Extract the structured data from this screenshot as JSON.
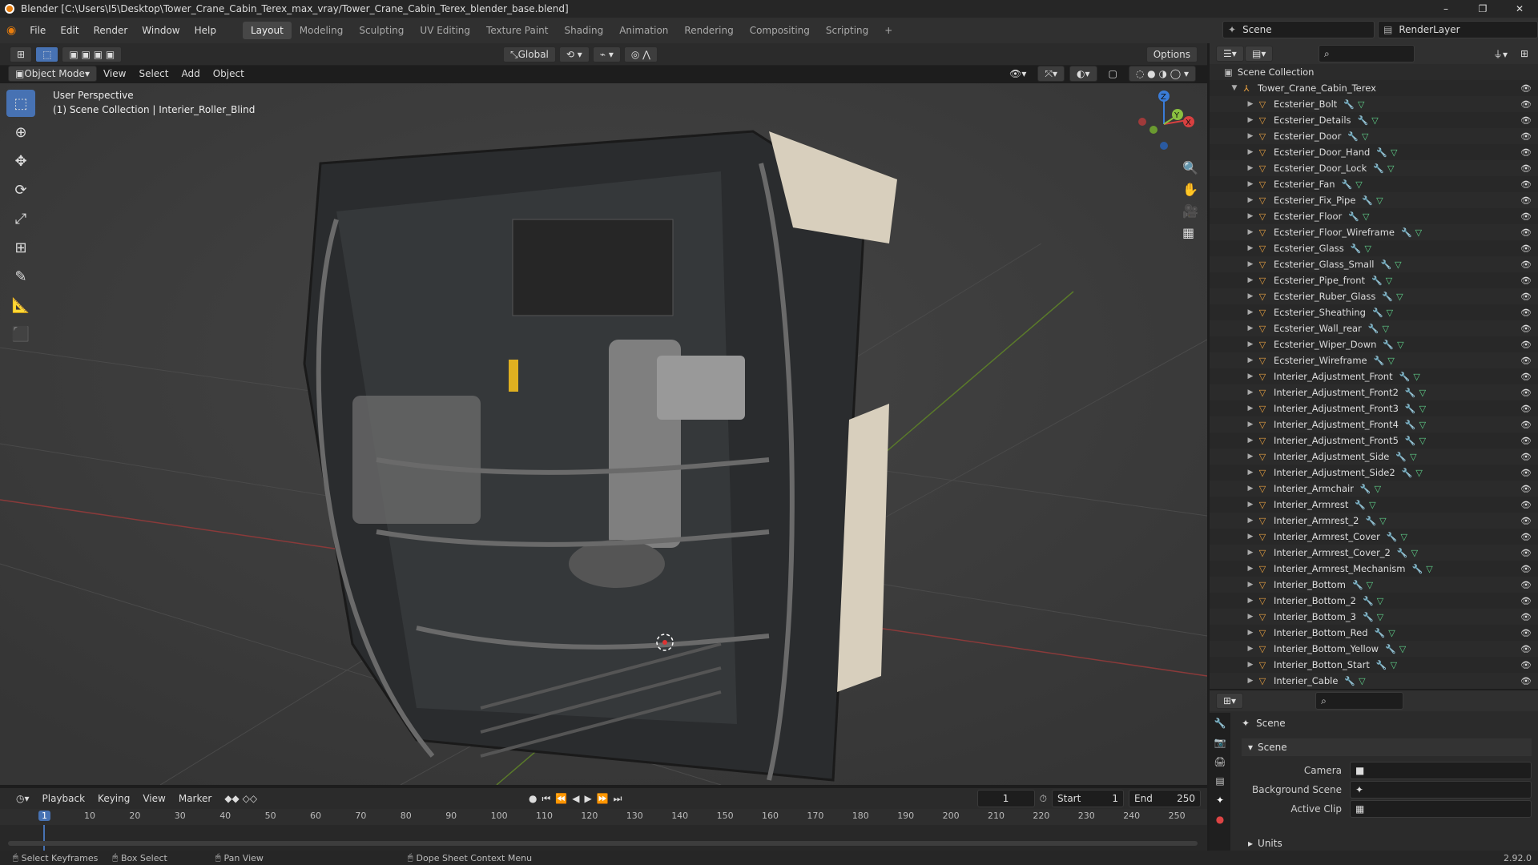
{
  "titlebar": {
    "title": "Blender [C:\\Users\\I5\\Desktop\\Tower_Crane_Cabin_Terex_max_vray/Tower_Crane_Cabin_Terex_blender_base.blend]",
    "min": "–",
    "max": "❐",
    "close": "✕"
  },
  "menu": {
    "items": [
      "File",
      "Edit",
      "Render",
      "Window",
      "Help"
    ]
  },
  "workspaces": [
    "Layout",
    "Modeling",
    "Sculpting",
    "UV Editing",
    "Texture Paint",
    "Shading",
    "Animation",
    "Rendering",
    "Compositing",
    "Scripting"
  ],
  "workspace_add": "+",
  "scene": {
    "name": "Scene",
    "layer": "RenderLayer"
  },
  "viewport": {
    "mode": "Object Mode",
    "menus": [
      "View",
      "Select",
      "Add",
      "Object"
    ],
    "transform": "Global",
    "options": "Options",
    "info_line1": "User Perspective",
    "info_line2": "(1) Scene Collection | Interier_Roller_Blind"
  },
  "gizmo": {
    "x": "X",
    "y": "Y",
    "z": "Z"
  },
  "outliner": {
    "root": "Scene Collection",
    "collection": "Tower_Crane_Cabin_Terex",
    "items": [
      "Ecsterier_Bolt",
      "Ecsterier_Details",
      "Ecsterier_Door",
      "Ecsterier_Door_Hand",
      "Ecsterier_Door_Lock",
      "Ecsterier_Fan",
      "Ecsterier_Fix_Pipe",
      "Ecsterier_Floor",
      "Ecsterier_Floor_Wireframe",
      "Ecsterier_Glass",
      "Ecsterier_Glass_Small",
      "Ecsterier_Pipe_front",
      "Ecsterier_Ruber_Glass",
      "Ecsterier_Sheathing",
      "Ecsterier_Wall_rear",
      "Ecsterier_Wiper_Down",
      "Ecsterier_Wireframe",
      "Interier_Adjustment_Front",
      "Interier_Adjustment_Front2",
      "Interier_Adjustment_Front3",
      "Interier_Adjustment_Front4",
      "Interier_Adjustment_Front5",
      "Interier_Adjustment_Side",
      "Interier_Adjustment_Side2",
      "Interier_Armchair",
      "Interier_Armrest",
      "Interier_Armrest_2",
      "Interier_Armrest_Cover",
      "Interier_Armrest_Cover_2",
      "Interier_Armrest_Mechanism",
      "Interier_Bottom",
      "Interier_Bottom_2",
      "Interier_Bottom_3",
      "Interier_Bottom_Red",
      "Interier_Bottom_Yellow",
      "Interier_Botton_Start",
      "Interier_Cable"
    ]
  },
  "properties": {
    "context": "Scene",
    "panel": "Scene",
    "camera_label": "Camera",
    "bg_label": "Background Scene",
    "clip_label": "Active Clip",
    "units_panel": "Units",
    "version": "2.92.0"
  },
  "timeline": {
    "menus": [
      "Playback",
      "Keying",
      "View",
      "Marker"
    ],
    "current_frame": "1",
    "start_label": "Start",
    "start": "1",
    "end_label": "End",
    "end": "250",
    "ticks": [
      "1",
      "10",
      "20",
      "30",
      "40",
      "50",
      "60",
      "70",
      "80",
      "90",
      "100",
      "110",
      "120",
      "130",
      "140",
      "150",
      "160",
      "170",
      "180",
      "190",
      "200",
      "210",
      "220",
      "230",
      "240",
      "250"
    ]
  },
  "status": {
    "select": "Select Keyframes",
    "box": "Box Select",
    "pan": "Pan View",
    "context": "Dope Sheet Context Menu"
  }
}
